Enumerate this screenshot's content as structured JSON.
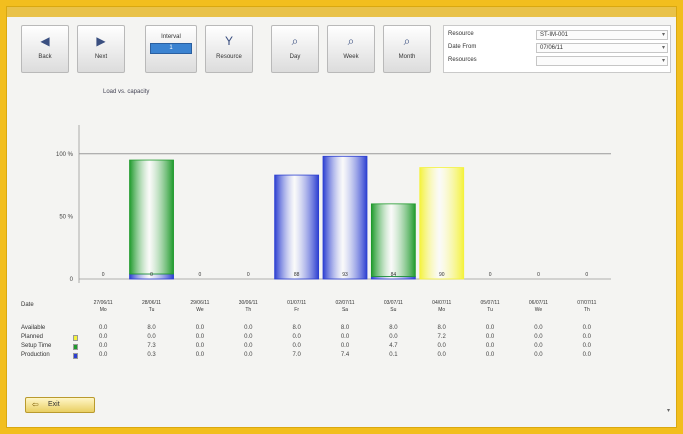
{
  "window": {
    "title": "",
    "controls": ""
  },
  "toolbar": {
    "buttons": [
      {
        "id": "back",
        "label": "Back",
        "icon": "arrow-left-icon",
        "glyph": "◀"
      },
      {
        "id": "next",
        "label": "Next",
        "icon": "arrow-right-icon",
        "glyph": "▶"
      },
      {
        "id": "resource",
        "label": "Resource",
        "icon": "funnel-icon",
        "glyph": "Y"
      },
      {
        "id": "day",
        "label": "Day",
        "icon": "magnifier-icon",
        "glyph": "⌕"
      },
      {
        "id": "week",
        "label": "Week",
        "icon": "magnifier-icon",
        "glyph": "⌕"
      },
      {
        "id": "month",
        "label": "Month",
        "icon": "magnifier-icon",
        "glyph": "⌕"
      }
    ],
    "interval": {
      "label": "Interval",
      "value": "1"
    }
  },
  "filters": [
    {
      "label": "Resource",
      "value": "ST-IM-001"
    },
    {
      "label": "Date From",
      "value": "07/06/11"
    },
    {
      "label": "Resources",
      "value": ""
    }
  ],
  "chart": {
    "title": "Load vs. capacity"
  },
  "chart_data": {
    "type": "bar",
    "categories": [
      "27/06/11",
      "28/06/11",
      "29/06/11",
      "30/06/11",
      "01/07/11",
      "02/07/11",
      "03/07/11",
      "04/07/11",
      "05/07/11",
      "06/07/11",
      "07/07/11"
    ],
    "y_ticks": [
      "100 %",
      "50 %",
      "0"
    ],
    "ylim": [
      0,
      115
    ],
    "capacity_line": 100,
    "bar_labels": [
      "0",
      "0",
      "0",
      "0",
      "88",
      "93",
      "84",
      "90",
      "0",
      "0",
      "0"
    ],
    "series": [
      {
        "values": [
          0,
          4,
          0,
          0,
          0,
          0,
          2,
          0,
          0,
          0,
          0
        ],
        "color": "#2c3fd1"
      },
      {
        "values": [
          0,
          91,
          0,
          0,
          0,
          0,
          58,
          0,
          0,
          0,
          0
        ],
        "color": "#1f9a2c"
      },
      {
        "values": [
          0,
          0,
          0,
          0,
          0,
          0,
          0,
          89,
          0,
          0,
          0
        ],
        "color": "#f4f23c"
      },
      {
        "values": [
          0,
          0,
          0,
          0,
          83,
          98,
          0,
          0,
          0,
          0,
          0
        ],
        "color": "#2c3fd1"
      }
    ]
  },
  "table": {
    "day_label": "Date",
    "day_sub": [
      "Mo",
      "Tu",
      "We",
      "Th",
      "Fr",
      "Sa",
      "Su",
      "Mo",
      "Tu",
      "We",
      "Th"
    ],
    "rows": [
      {
        "label": "Available",
        "swatch": "",
        "values": [
          "0.0",
          "8.0",
          "0.0",
          "0.0",
          "8.0",
          "8.0",
          "8.0",
          "8.0",
          "0.0",
          "0.0",
          "0.0"
        ]
      },
      {
        "label": "Planned",
        "swatch": "#f4f23c",
        "values": [
          "0.0",
          "0.0",
          "0.0",
          "0.0",
          "0.0",
          "0.0",
          "0.0",
          "7.2",
          "0.0",
          "0.0",
          "0.0"
        ]
      },
      {
        "label": "Setup Time",
        "swatch": "#1f9a2c",
        "values": [
          "0.0",
          "7.3",
          "0.0",
          "0.0",
          "0.0",
          "0.0",
          "4.7",
          "0.0",
          "0.0",
          "0.0",
          "0.0"
        ]
      },
      {
        "label": "Production",
        "swatch": "#2c3fd1",
        "values": [
          "0.0",
          "0.3",
          "0.0",
          "0.0",
          "7.0",
          "7.4",
          "0.1",
          "0.0",
          "0.0",
          "0.0",
          "0.0"
        ]
      }
    ]
  },
  "footer": {
    "exit_label": "Exit",
    "scroll": "▾"
  }
}
